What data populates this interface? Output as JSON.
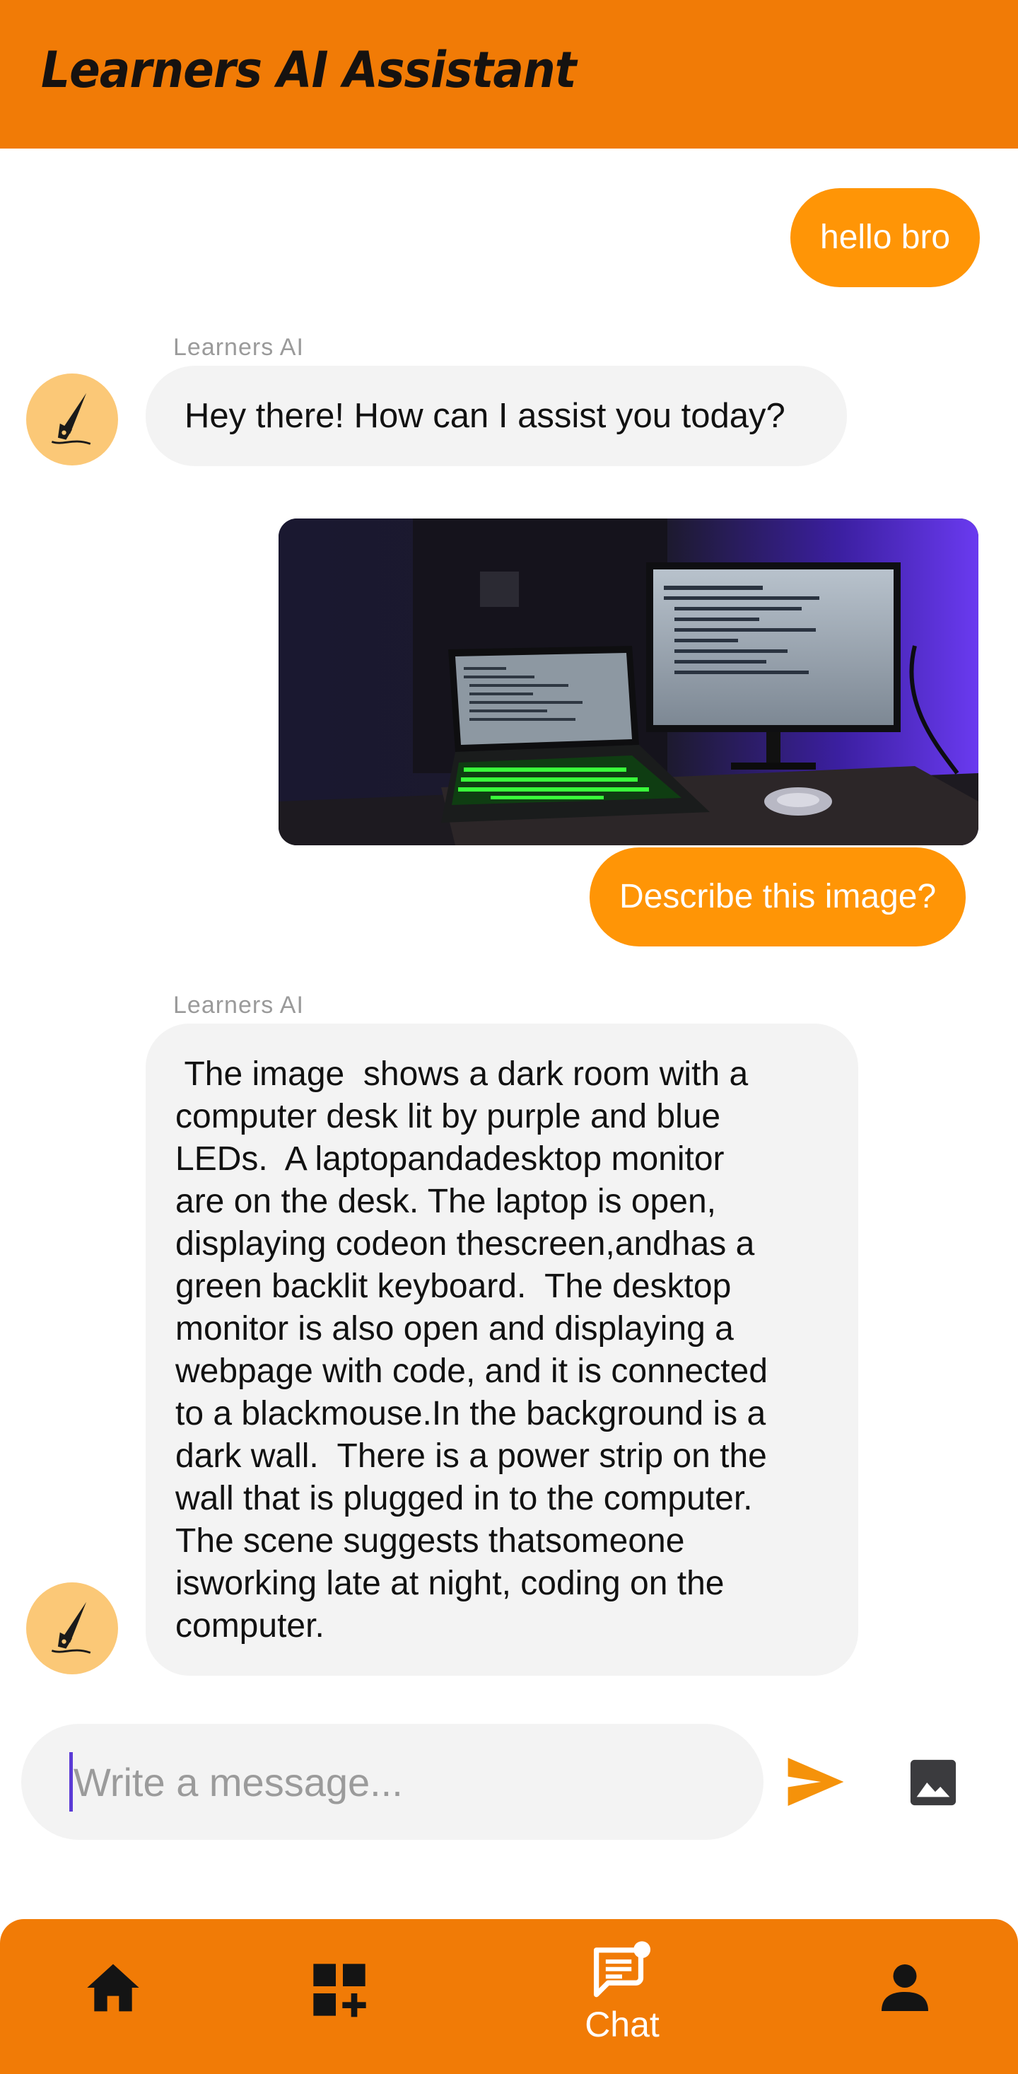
{
  "header": {
    "title": "Learners AI Assistant"
  },
  "messages": [
    {
      "role": "user",
      "text": "hello bro"
    },
    {
      "role": "assistant",
      "sender": "Learners AI",
      "text": "Hey there! How can I assist you today?"
    },
    {
      "role": "user",
      "image": "desk-setup-photo",
      "text": "Describe this image?"
    },
    {
      "role": "assistant",
      "sender": "Learners AI",
      "lines": [
        " The image  shows a dark room with a",
        "computer desk lit by purple and blue",
        "LEDs.  A laptopandadesktop monitor",
        "are on the desk. The laptop is open,",
        "displaying codeon thescreen,andhas a",
        "green backlit keyboard.  The desktop",
        "monitor is also open and displaying a",
        "webpage with code, and it is connected",
        "to a blackmouse.In the background is a",
        "dark wall.  There is a power strip on the",
        "wall that is plugged in to the computer.",
        "The scene suggests thatsomeone",
        "isworking late at night, coding on the",
        "computer."
      ]
    }
  ],
  "composer": {
    "placeholder": "Write a message...",
    "value": ""
  },
  "icons": {
    "send": "send-icon",
    "image": "image-icon",
    "avatar": "pen-nib-icon"
  },
  "nav": {
    "items": [
      {
        "icon": "home-icon",
        "label": ""
      },
      {
        "icon": "add-widget-icon",
        "label": ""
      },
      {
        "icon": "chat-icon",
        "label": "Chat",
        "active": true
      },
      {
        "icon": "person-icon",
        "label": ""
      }
    ]
  },
  "colors": {
    "app_bar": "#f17b06",
    "user_bubble": "#ff9506",
    "ai_bubble": "#f3f3f3",
    "avatar_bg": "#fbc877",
    "send_icon": "#f5920a"
  }
}
